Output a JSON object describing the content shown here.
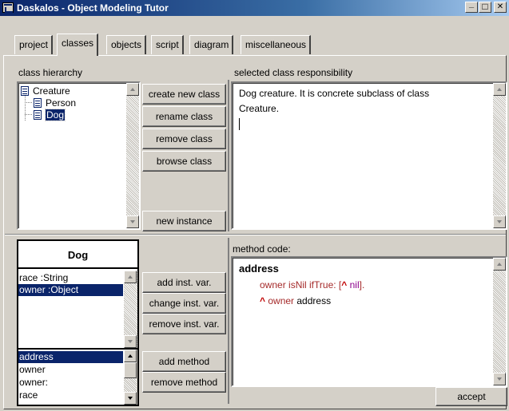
{
  "window": {
    "title": "Daskalos - Object Modeling Tutor",
    "controls": {
      "minimize": "_",
      "maximize": "□",
      "close": "✕"
    }
  },
  "tabs": [
    {
      "label": "project",
      "active": false
    },
    {
      "label": "classes",
      "active": true
    },
    {
      "label": "objects",
      "active": false
    },
    {
      "label": "script",
      "active": false
    },
    {
      "label": "diagram",
      "active": false
    },
    {
      "label": "miscellaneous",
      "active": false
    }
  ],
  "class_hierarchy": {
    "label": "class hierarchy",
    "root": "Creature",
    "children": [
      "Person",
      "Dog"
    ],
    "selected": "Dog"
  },
  "class_buttons": {
    "create": "create new class",
    "rename": "rename class",
    "remove": "remove class",
    "browse": "browse class",
    "new_instance": "new instance"
  },
  "responsibility": {
    "label": "selected class responsibility",
    "line1": "Dog creature.  It is concrete subclass of class",
    "line2": "Creature."
  },
  "class_card": {
    "name": "Dog",
    "inst_vars": [
      "race :String",
      "owner :Object"
    ],
    "selected_inst_var": "owner :Object",
    "methods": [
      "address",
      "owner",
      "owner:",
      "race"
    ],
    "selected_method": "address"
  },
  "var_buttons": {
    "add": "add inst. var.",
    "change": "change inst. var.",
    "remove": "remove inst. var."
  },
  "method_buttons": {
    "add": "add method",
    "remove": "remove method"
  },
  "method_code": {
    "label": "method code:",
    "header": "address",
    "line1_receiver": "owner",
    "line1_message": " isNil ifTrue: [",
    "line1_caret": "^",
    "line1_nil": " nil",
    "line1_end": "].",
    "line2_caret": "^",
    "line2_receiver": " owner",
    "line2_message": " address"
  },
  "accept_label": "accept",
  "colors": {
    "title_bar": "#0a246a",
    "face": "#d4d0c8",
    "selection": "#0a246a",
    "keyword": "#a52a2a",
    "nil": "#8b008b"
  }
}
